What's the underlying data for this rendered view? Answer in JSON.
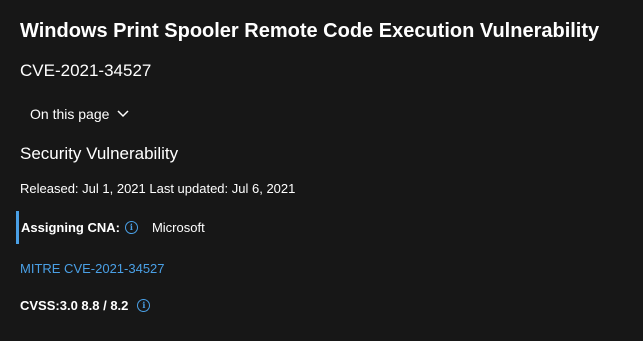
{
  "header": {
    "title": "Windows Print Spooler Remote Code Execution Vulnerability",
    "cve_id": "CVE-2021-34527"
  },
  "on_this_page": {
    "label": "On this page",
    "icon": "chevron-down-icon"
  },
  "security": {
    "section_title": "Security Vulnerability",
    "dates": "Released: Jul 1, 2021 Last updated: Jul 6, 2021",
    "cna_label": "Assigning CNA:",
    "cna_value": "Microsoft",
    "mitre_link": "MITRE CVE-2021-34527",
    "cvss": "CVSS:3.0 8.8 / 8.2"
  },
  "colors": {
    "background": "#171717",
    "text": "#ffffff",
    "accent": "#4aa0e6"
  },
  "icons": {
    "info": "info-icon"
  }
}
